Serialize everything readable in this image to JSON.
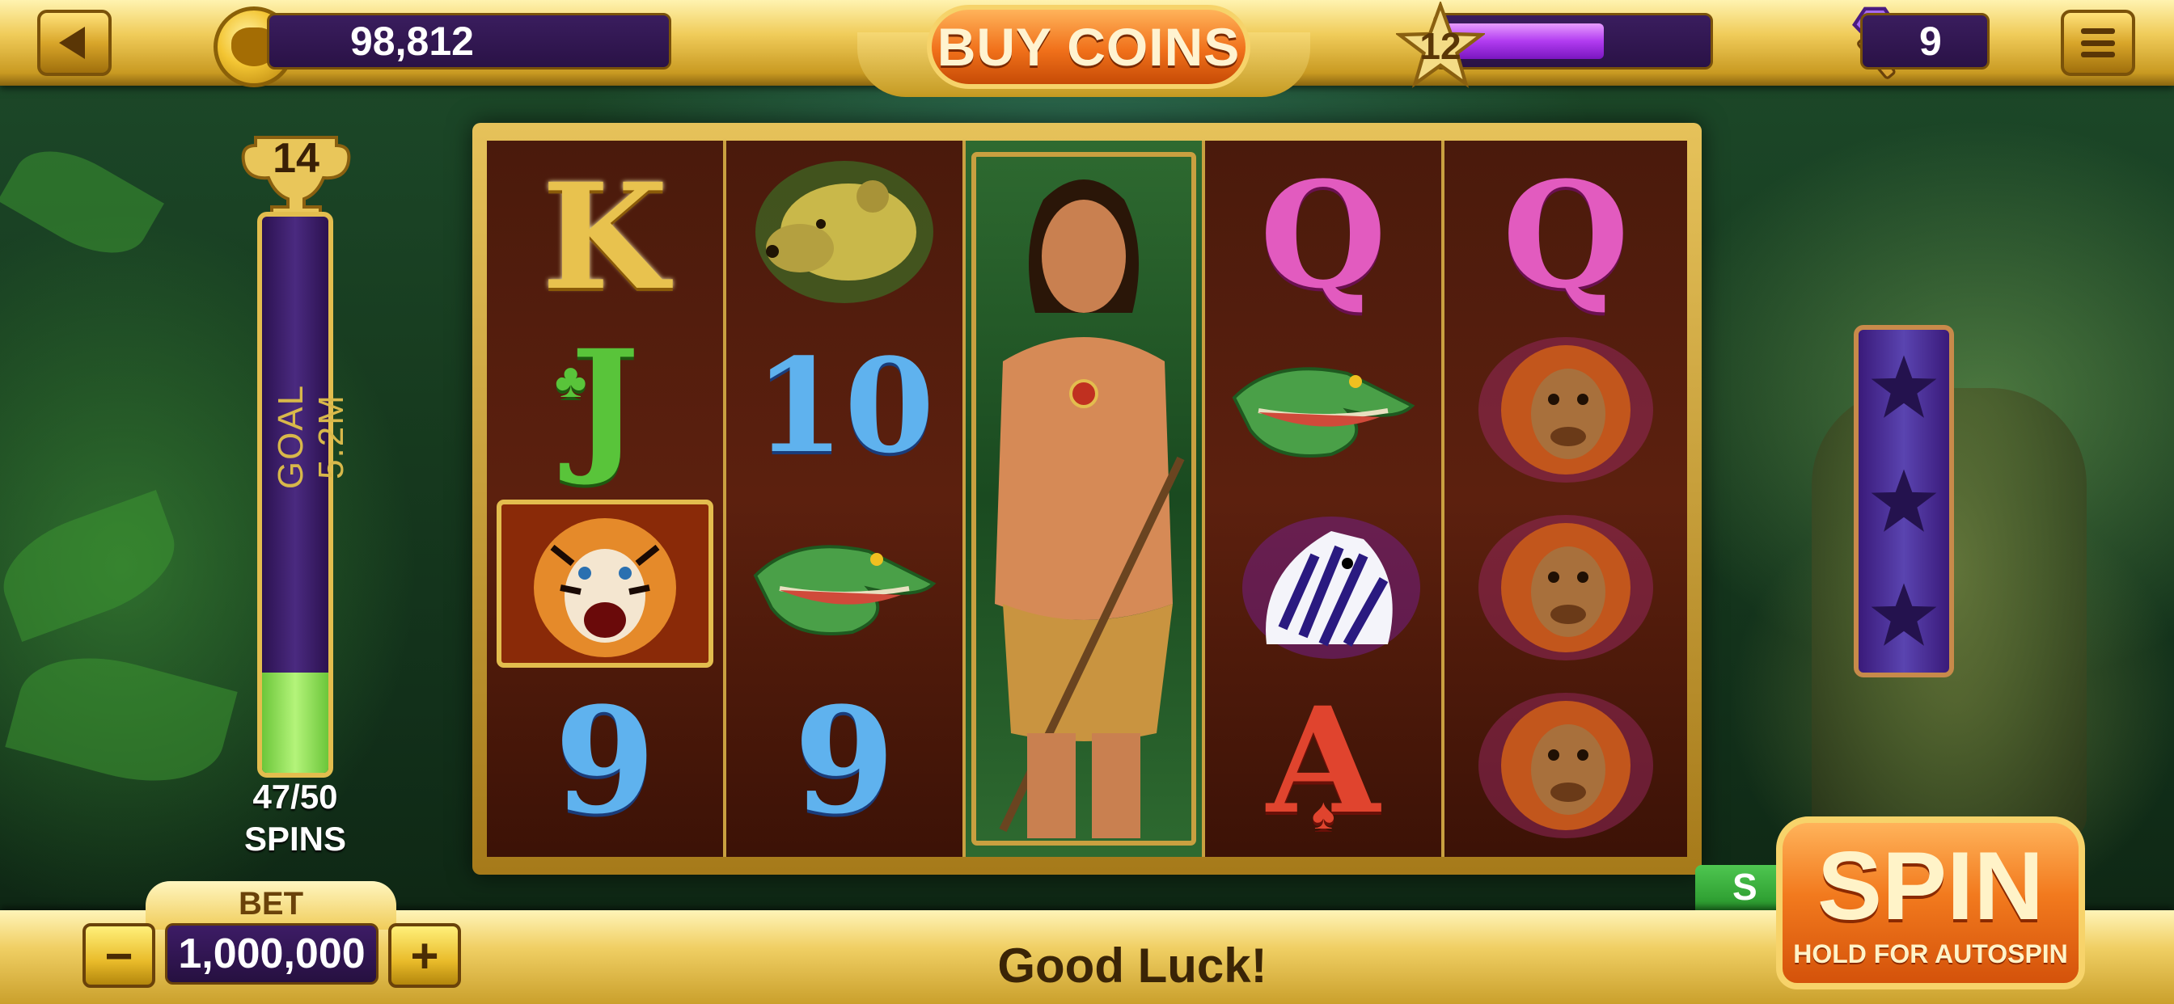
{
  "top_bar": {
    "coin_balance": "98,812",
    "buy_coins_label": "BUY COINS",
    "level": "12",
    "xp_progress": 0.62,
    "gem_count": "9"
  },
  "goal_meter": {
    "trophy_count": "14",
    "goal_label": "GOAL 5.2M",
    "spins_progress": "47/50",
    "spins_word": "SPINS",
    "fill_fraction": 0.18
  },
  "reels": [
    {
      "symbols": [
        "K",
        "J",
        "tiger",
        "9"
      ]
    },
    {
      "symbols": [
        "hyena",
        "10",
        "crocodile",
        "9"
      ]
    },
    {
      "symbols": [
        "tarzan-wild"
      ]
    },
    {
      "symbols": [
        "Q",
        "crocodile",
        "zebra",
        "A"
      ]
    },
    {
      "symbols": [
        "Q",
        "orangutan",
        "orangutan",
        "orangutan"
      ]
    }
  ],
  "star_meter": {
    "stars_filled": 3
  },
  "bottom_bar": {
    "bet_label": "BET",
    "bet_value": "1,000,000",
    "minus_label": "−",
    "plus_label": "+",
    "status_text": "Good Luck!",
    "spin_label": "SPIN",
    "spin_sub_label": "HOLD FOR AUTOSPIN",
    "side_tab_label": "S"
  },
  "colors": {
    "gold": "#e3bd4e",
    "purple": "#3a1d5e",
    "orange": "#f0701a",
    "green_fill": "#6cc63a"
  }
}
